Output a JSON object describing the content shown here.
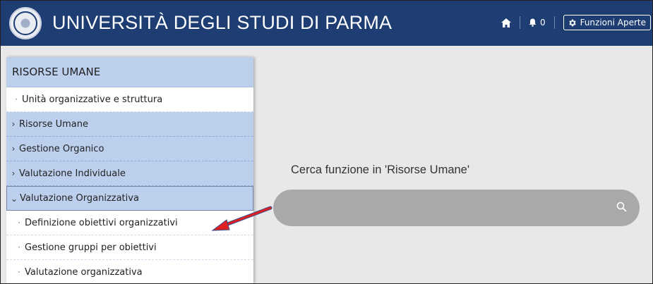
{
  "header": {
    "brand": "UNIVERSITÀ DEGLI STUDI DI PARMA",
    "notification_count": "0",
    "open_functions_label": "Funzioni Aperte",
    "bg_color": "#1d3d73"
  },
  "sidebar": {
    "title": "RISORSE UMANE",
    "items": [
      {
        "label": "Unità organizzative e struttura",
        "marker": "·",
        "style": "white"
      },
      {
        "label": "Risorse Umane",
        "marker": "›",
        "style": "blue"
      },
      {
        "label": "Gestione Organico",
        "marker": "›",
        "style": "blue"
      },
      {
        "label": "Valutazione Individuale",
        "marker": "›",
        "style": "blue"
      },
      {
        "label": "Valutazione Organizzativa",
        "marker": "⌄",
        "style": "open"
      },
      {
        "label": "Definizione obiettivi organizzativi",
        "marker": "·",
        "style": "sub"
      },
      {
        "label": "Gestione gruppi per obiettivi",
        "marker": "·",
        "style": "sub"
      },
      {
        "label": "Valutazione organizzativa",
        "marker": "·",
        "style": "sub"
      }
    ]
  },
  "main": {
    "search_label": "Cerca funzione in 'Risorse Umane'",
    "search_value": "",
    "search_placeholder": ""
  },
  "colors": {
    "sidebar_highlight": "#bcd0ee",
    "search_bg": "#a9a9a9",
    "annotation_arrow": "#e02020"
  }
}
